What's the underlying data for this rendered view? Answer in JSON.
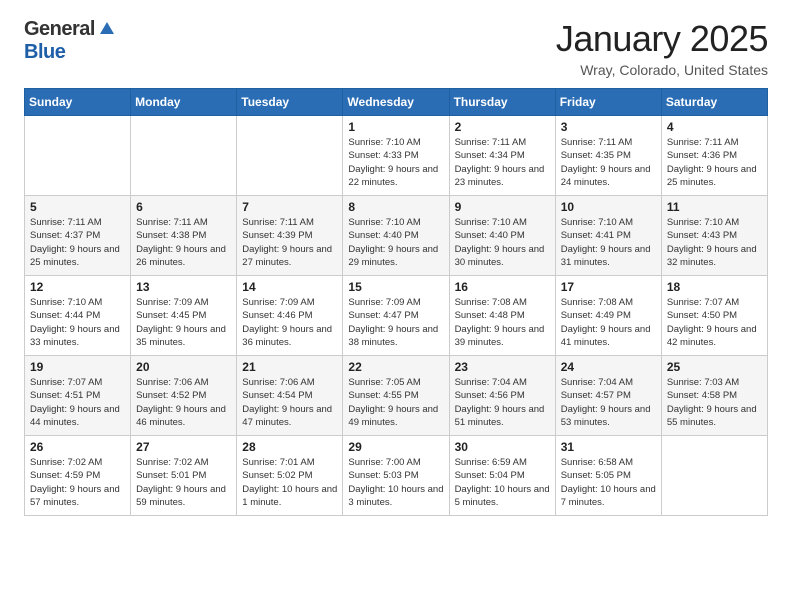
{
  "header": {
    "logo_general": "General",
    "logo_blue": "Blue",
    "title": "January 2025",
    "location": "Wray, Colorado, United States"
  },
  "weekdays": [
    "Sunday",
    "Monday",
    "Tuesday",
    "Wednesday",
    "Thursday",
    "Friday",
    "Saturday"
  ],
  "weeks": [
    [
      {
        "day": "",
        "info": ""
      },
      {
        "day": "",
        "info": ""
      },
      {
        "day": "",
        "info": ""
      },
      {
        "day": "1",
        "info": "Sunrise: 7:10 AM\nSunset: 4:33 PM\nDaylight: 9 hours\nand 22 minutes."
      },
      {
        "day": "2",
        "info": "Sunrise: 7:11 AM\nSunset: 4:34 PM\nDaylight: 9 hours\nand 23 minutes."
      },
      {
        "day": "3",
        "info": "Sunrise: 7:11 AM\nSunset: 4:35 PM\nDaylight: 9 hours\nand 24 minutes."
      },
      {
        "day": "4",
        "info": "Sunrise: 7:11 AM\nSunset: 4:36 PM\nDaylight: 9 hours\nand 25 minutes."
      }
    ],
    [
      {
        "day": "5",
        "info": "Sunrise: 7:11 AM\nSunset: 4:37 PM\nDaylight: 9 hours\nand 25 minutes."
      },
      {
        "day": "6",
        "info": "Sunrise: 7:11 AM\nSunset: 4:38 PM\nDaylight: 9 hours\nand 26 minutes."
      },
      {
        "day": "7",
        "info": "Sunrise: 7:11 AM\nSunset: 4:39 PM\nDaylight: 9 hours\nand 27 minutes."
      },
      {
        "day": "8",
        "info": "Sunrise: 7:10 AM\nSunset: 4:40 PM\nDaylight: 9 hours\nand 29 minutes."
      },
      {
        "day": "9",
        "info": "Sunrise: 7:10 AM\nSunset: 4:40 PM\nDaylight: 9 hours\nand 30 minutes."
      },
      {
        "day": "10",
        "info": "Sunrise: 7:10 AM\nSunset: 4:41 PM\nDaylight: 9 hours\nand 31 minutes."
      },
      {
        "day": "11",
        "info": "Sunrise: 7:10 AM\nSunset: 4:43 PM\nDaylight: 9 hours\nand 32 minutes."
      }
    ],
    [
      {
        "day": "12",
        "info": "Sunrise: 7:10 AM\nSunset: 4:44 PM\nDaylight: 9 hours\nand 33 minutes."
      },
      {
        "day": "13",
        "info": "Sunrise: 7:09 AM\nSunset: 4:45 PM\nDaylight: 9 hours\nand 35 minutes."
      },
      {
        "day": "14",
        "info": "Sunrise: 7:09 AM\nSunset: 4:46 PM\nDaylight: 9 hours\nand 36 minutes."
      },
      {
        "day": "15",
        "info": "Sunrise: 7:09 AM\nSunset: 4:47 PM\nDaylight: 9 hours\nand 38 minutes."
      },
      {
        "day": "16",
        "info": "Sunrise: 7:08 AM\nSunset: 4:48 PM\nDaylight: 9 hours\nand 39 minutes."
      },
      {
        "day": "17",
        "info": "Sunrise: 7:08 AM\nSunset: 4:49 PM\nDaylight: 9 hours\nand 41 minutes."
      },
      {
        "day": "18",
        "info": "Sunrise: 7:07 AM\nSunset: 4:50 PM\nDaylight: 9 hours\nand 42 minutes."
      }
    ],
    [
      {
        "day": "19",
        "info": "Sunrise: 7:07 AM\nSunset: 4:51 PM\nDaylight: 9 hours\nand 44 minutes."
      },
      {
        "day": "20",
        "info": "Sunrise: 7:06 AM\nSunset: 4:52 PM\nDaylight: 9 hours\nand 46 minutes."
      },
      {
        "day": "21",
        "info": "Sunrise: 7:06 AM\nSunset: 4:54 PM\nDaylight: 9 hours\nand 47 minutes."
      },
      {
        "day": "22",
        "info": "Sunrise: 7:05 AM\nSunset: 4:55 PM\nDaylight: 9 hours\nand 49 minutes."
      },
      {
        "day": "23",
        "info": "Sunrise: 7:04 AM\nSunset: 4:56 PM\nDaylight: 9 hours\nand 51 minutes."
      },
      {
        "day": "24",
        "info": "Sunrise: 7:04 AM\nSunset: 4:57 PM\nDaylight: 9 hours\nand 53 minutes."
      },
      {
        "day": "25",
        "info": "Sunrise: 7:03 AM\nSunset: 4:58 PM\nDaylight: 9 hours\nand 55 minutes."
      }
    ],
    [
      {
        "day": "26",
        "info": "Sunrise: 7:02 AM\nSunset: 4:59 PM\nDaylight: 9 hours\nand 57 minutes."
      },
      {
        "day": "27",
        "info": "Sunrise: 7:02 AM\nSunset: 5:01 PM\nDaylight: 9 hours\nand 59 minutes."
      },
      {
        "day": "28",
        "info": "Sunrise: 7:01 AM\nSunset: 5:02 PM\nDaylight: 10 hours\nand 1 minute."
      },
      {
        "day": "29",
        "info": "Sunrise: 7:00 AM\nSunset: 5:03 PM\nDaylight: 10 hours\nand 3 minutes."
      },
      {
        "day": "30",
        "info": "Sunrise: 6:59 AM\nSunset: 5:04 PM\nDaylight: 10 hours\nand 5 minutes."
      },
      {
        "day": "31",
        "info": "Sunrise: 6:58 AM\nSunset: 5:05 PM\nDaylight: 10 hours\nand 7 minutes."
      },
      {
        "day": "",
        "info": ""
      }
    ]
  ]
}
